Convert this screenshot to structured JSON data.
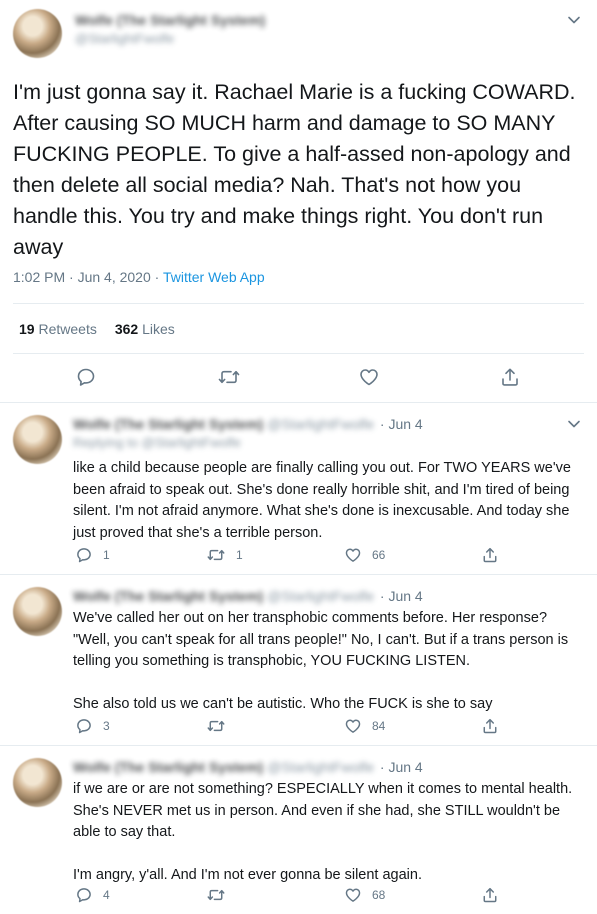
{
  "main_tweet": {
    "display_name": "Wolfe (The Starlight System)",
    "handle": "@StarlightFwolfe",
    "text": "I'm just gonna say it. Rachael Marie is a fucking COWARD. After causing SO MUCH harm and damage to SO MANY FUCKING PEOPLE. To give a half-assed non-apology and then delete all social media? Nah. That's not how you handle this. You try and make things right. You don't run away",
    "time": "1:02 PM · Jun 4, 2020 · ",
    "source": "Twitter Web App",
    "retweets_count": "19",
    "retweets_label": "Retweets",
    "likes_count": "362",
    "likes_label": "Likes"
  },
  "replies": [
    {
      "display_name": "Wolfe (The Starlight System)",
      "handle": "@StarlightFwolfe",
      "date": "· Jun 4",
      "replying_to": "Replying to @StarlightFwolfe",
      "text": "like a child because people are finally calling you out. For TWO YEARS we've been afraid to speak out. She's done really horrible shit, and I'm tired of being silent. I'm not afraid anymore. What she's done is inexcusable. And today she just proved that she's a terrible person.",
      "reply_count": "1",
      "retweet_count": "1",
      "like_count": "66"
    },
    {
      "display_name": "Wolfe (The Starlight System)",
      "handle": "@StarlightFwolfe",
      "date": "· Jun 4",
      "text": "We've called her out on her transphobic comments before. Her response? \"Well, you can't speak for all trans people!\" No, I can't. But if a trans person is telling you something is transphobic, YOU FUCKING LISTEN.\n\nShe also told us we can't be autistic. Who the FUCK is she to say",
      "reply_count": "3",
      "retweet_count": "",
      "like_count": "84"
    },
    {
      "display_name": "Wolfe (The Starlight System)",
      "handle": "@StarlightFwolfe",
      "date": "· Jun 4",
      "text": "if we are or are not something? ESPECIALLY when it comes to mental health. She's NEVER met us in person. And even if she had, she STILL wouldn't be able to say that.\n\nI'm angry, y'all. And I'm not ever gonna be silent again.",
      "reply_count": "4",
      "retweet_count": "",
      "like_count": "68"
    }
  ],
  "icons": {
    "reply": "reply-icon",
    "retweet": "retweet-icon",
    "like": "heart-icon",
    "share": "share-icon",
    "more": "chevron-down-icon"
  },
  "colors": {
    "text": "#14171a",
    "secondary": "#657786",
    "link": "#1b95e0",
    "divider": "#e6ecf0"
  }
}
